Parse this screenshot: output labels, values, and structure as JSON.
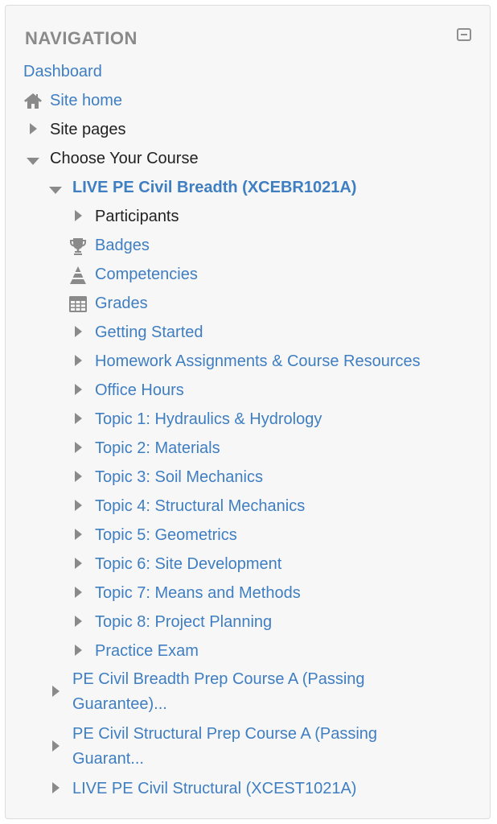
{
  "block": {
    "title": "NAVIGATION",
    "collapse_icon": "collapse-icon"
  },
  "nav": {
    "dashboard": "Dashboard",
    "site_home": "Site home",
    "site_pages": "Site pages",
    "choose_course": "Choose Your Course",
    "current_course": "LIVE PE Civil Breadth (XCEBR1021A)",
    "participants": "Participants",
    "badges": "Badges",
    "competencies": "Competencies",
    "grades": "Grades",
    "sections": [
      "Getting Started",
      "Homework Assignments & Course Resources",
      "Office Hours",
      "Topic 1: Hydraulics & Hydrology",
      "Topic 2: Materials",
      "Topic 3: Soil Mechanics",
      "Topic 4: Structural Mechanics",
      "Topic 5: Geometrics",
      "Topic 6: Site Development",
      "Topic 7: Means and Methods",
      "Topic 8: Project Planning",
      "Practice Exam"
    ],
    "other_courses": [
      "PE Civil Breadth Prep Course A (Passing Guarantee)...",
      "PE Civil Structural Prep Course A (Passing Guarant...",
      "LIVE PE Civil Structural (XCEST1021A)"
    ]
  },
  "icons": {
    "home": "home-icon",
    "badges": "trophy-icon",
    "competencies": "pyramid-icon",
    "grades": "table-icon",
    "expand": "triangle-right-icon",
    "collapse": "triangle-down-icon"
  },
  "colors": {
    "link": "#3f7ec1",
    "text": "#222222",
    "title": "#8a8a8a",
    "icon": "#8a8a8a",
    "background": "#f7f7f7"
  }
}
